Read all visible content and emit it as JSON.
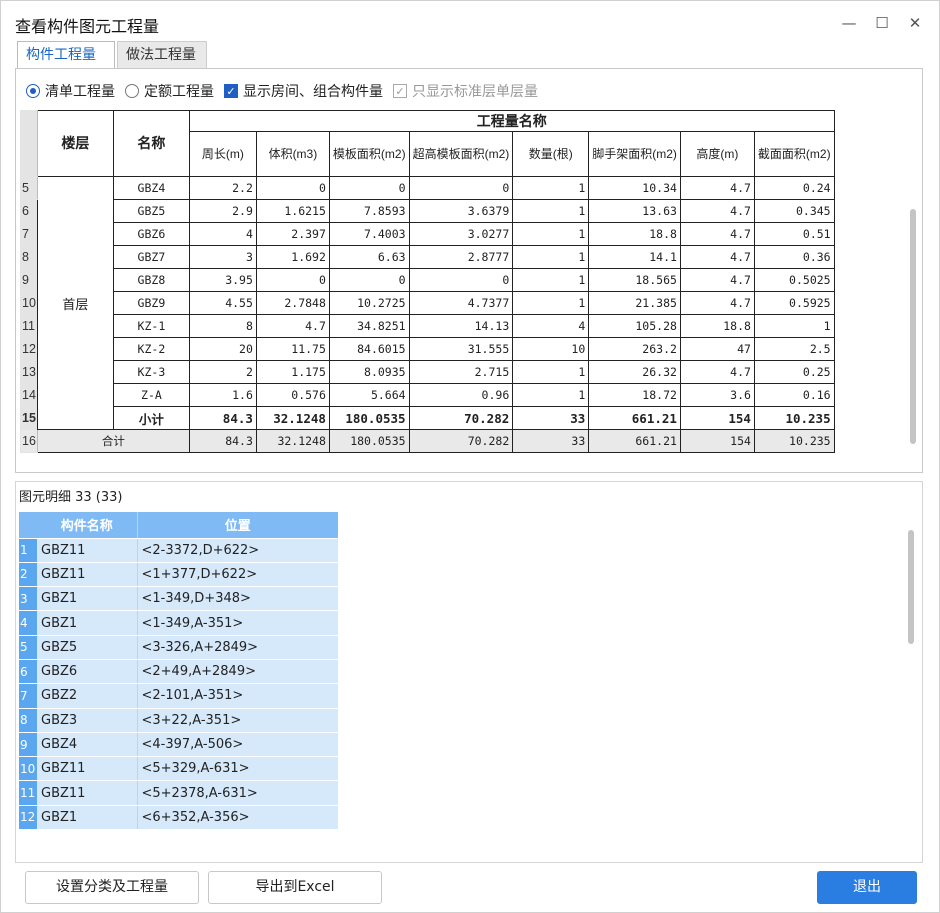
{
  "window": {
    "title": "查看构件图元工程量",
    "min": "—",
    "max": "☐",
    "close": "✕"
  },
  "tabs": [
    {
      "label": "构件工程量",
      "active": true
    },
    {
      "label": "做法工程量",
      "active": false
    }
  ],
  "options": {
    "radio1": "清单工程量",
    "radio2": "定额工程量",
    "check1": "显示房间、组合构件量",
    "check2": "只显示标准层单层量"
  },
  "qty_table": {
    "header_floor": "楼层",
    "header_name": "名称",
    "header_group": "工程量名称",
    "columns": [
      "周长(m)",
      "体积(m3)",
      "模板面积(m2)",
      "超高模板面积(m2)",
      "数量(根)",
      "脚手架面积(m2)",
      "高度(m)",
      "截面面积(m2)"
    ],
    "floor": "首层",
    "rows": [
      {
        "n": "5",
        "name": "GBZ4",
        "v": [
          "2.2",
          "0",
          "0",
          "0",
          "1",
          "10.34",
          "4.7",
          "0.24"
        ]
      },
      {
        "n": "6",
        "name": "GBZ5",
        "v": [
          "2.9",
          "1.6215",
          "7.8593",
          "3.6379",
          "1",
          "13.63",
          "4.7",
          "0.345"
        ]
      },
      {
        "n": "7",
        "name": "GBZ6",
        "v": [
          "4",
          "2.397",
          "7.4003",
          "3.0277",
          "1",
          "18.8",
          "4.7",
          "0.51"
        ]
      },
      {
        "n": "8",
        "name": "GBZ7",
        "v": [
          "3",
          "1.692",
          "6.63",
          "2.8777",
          "1",
          "14.1",
          "4.7",
          "0.36"
        ]
      },
      {
        "n": "9",
        "name": "GBZ8",
        "v": [
          "3.95",
          "0",
          "0",
          "0",
          "1",
          "18.565",
          "4.7",
          "0.5025"
        ]
      },
      {
        "n": "10",
        "name": "GBZ9",
        "v": [
          "4.55",
          "2.7848",
          "10.2725",
          "4.7377",
          "1",
          "21.385",
          "4.7",
          "0.5925"
        ]
      },
      {
        "n": "11",
        "name": "KZ-1",
        "v": [
          "8",
          "4.7",
          "34.8251",
          "14.13",
          "4",
          "105.28",
          "18.8",
          "1"
        ]
      },
      {
        "n": "12",
        "name": "KZ-2",
        "v": [
          "20",
          "11.75",
          "84.6015",
          "31.555",
          "10",
          "263.2",
          "47",
          "2.5"
        ]
      },
      {
        "n": "13",
        "name": "KZ-3",
        "v": [
          "2",
          "1.175",
          "8.0935",
          "2.715",
          "1",
          "26.32",
          "4.7",
          "0.25"
        ]
      },
      {
        "n": "14",
        "name": "Z-A",
        "v": [
          "1.6",
          "0.576",
          "5.664",
          "0.96",
          "1",
          "18.72",
          "3.6",
          "0.16"
        ]
      }
    ],
    "subtotal": {
      "n": "15",
      "name": "小计",
      "v": [
        "84.3",
        "32.1248",
        "180.0535",
        "70.282",
        "33",
        "661.21",
        "154",
        "10.235"
      ]
    },
    "total": {
      "n": "16",
      "name": "合计",
      "v": [
        "84.3",
        "32.1248",
        "180.0535",
        "70.282",
        "33",
        "661.21",
        "154",
        "10.235"
      ]
    }
  },
  "detail": {
    "title": "图元明细  33 (33)",
    "col1": "构件名称",
    "col2": "位置",
    "rows": [
      {
        "n": "1",
        "name": "GBZ11",
        "pos": "<2-3372,D+622>"
      },
      {
        "n": "2",
        "name": "GBZ11",
        "pos": "<1+377,D+622>"
      },
      {
        "n": "3",
        "name": "GBZ1",
        "pos": "<1-349,D+348>"
      },
      {
        "n": "4",
        "name": "GBZ1",
        "pos": "<1-349,A-351>"
      },
      {
        "n": "5",
        "name": "GBZ5",
        "pos": "<3-326,A+2849>"
      },
      {
        "n": "6",
        "name": "GBZ6",
        "pos": "<2+49,A+2849>"
      },
      {
        "n": "7",
        "name": "GBZ2",
        "pos": "<2-101,A-351>"
      },
      {
        "n": "8",
        "name": "GBZ3",
        "pos": "<3+22,A-351>"
      },
      {
        "n": "9",
        "name": "GBZ4",
        "pos": "<4-397,A-506>"
      },
      {
        "n": "10",
        "name": "GBZ11",
        "pos": "<5+329,A-631>"
      },
      {
        "n": "11",
        "name": "GBZ11",
        "pos": "<5+2378,A-631>"
      },
      {
        "n": "12",
        "name": "GBZ1",
        "pos": "<6+352,A-356>"
      }
    ]
  },
  "buttons": {
    "settings": "设置分类及工程量",
    "export": "导出到Excel",
    "exit": "退出"
  }
}
